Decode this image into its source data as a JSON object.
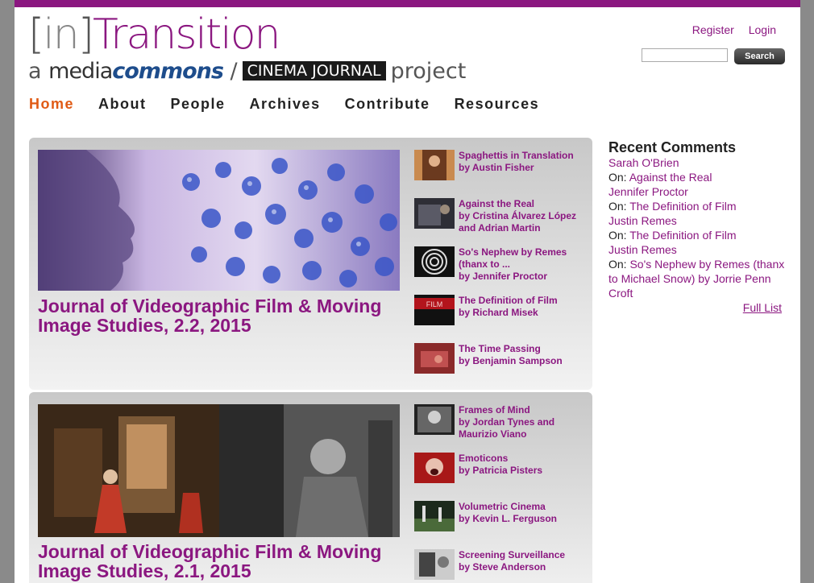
{
  "header": {
    "logo_bracket_left": "[",
    "logo_in": "in",
    "logo_bracket_right": "]",
    "logo_transition": "Transition",
    "tagline_a": "a",
    "tagline_media": "media",
    "tagline_commons": "commons",
    "tagline_slash": "/",
    "tagline_cinema_journal": "CINEMA JOURNAL",
    "tagline_project": "project"
  },
  "user_links": {
    "register": "Register",
    "login": "Login"
  },
  "search": {
    "button_label": "Search",
    "placeholder": ""
  },
  "nav": {
    "items": [
      {
        "label": "Home",
        "active": true
      },
      {
        "label": "About"
      },
      {
        "label": "People"
      },
      {
        "label": "Archives"
      },
      {
        "label": "Contribute"
      },
      {
        "label": "Resources"
      }
    ]
  },
  "issues": [
    {
      "title": "Journal of Videographic Film & Moving Image Studies, 2.2, 2015",
      "articles": [
        {
          "title": "Spaghettis in Translation",
          "by": "by Austin Fisher"
        },
        {
          "title": "Against the Real",
          "by": "by Cristina Álvarez López and Adrian Martin"
        },
        {
          "title": "So's Nephew by Remes (thanx to ...",
          "by": "by Jennifer Proctor"
        },
        {
          "title": "The Definition of Film",
          "by": "by Richard Misek",
          "thumb_text": "FILM"
        },
        {
          "title": "The Time Passing",
          "by": "by Benjamin Sampson"
        }
      ]
    },
    {
      "title": "Journal of Videographic Film & Moving Image Studies, 2.1, 2015",
      "articles": [
        {
          "title": "Frames of Mind",
          "by": "by Jordan Tynes and Maurizio Viano"
        },
        {
          "title": "Emoticons",
          "by": "by Patricia Pisters"
        },
        {
          "title": "Volumetric Cinema",
          "by": "by Kevin L. Ferguson"
        },
        {
          "title": "Screening Surveillance",
          "by": "by Steve Anderson"
        }
      ]
    }
  ],
  "sidebar": {
    "heading": "Recent Comments",
    "on_label": "On:",
    "comments": [
      {
        "author": "Sarah O'Brien",
        "post": "Against the Real"
      },
      {
        "author": "Jennifer Proctor",
        "post": "The Definition of Film"
      },
      {
        "author": "Justin Remes",
        "post": "The Definition of Film"
      },
      {
        "author": "Justin Remes",
        "post": "So's Nephew by Remes (thanx to Michael Snow) by Jorrie Penn Croft"
      }
    ],
    "full_list": "Full List"
  },
  "colors": {
    "accent": "#8b1780",
    "active_nav": "#e05a14",
    "frame": "#8a8a8a"
  }
}
